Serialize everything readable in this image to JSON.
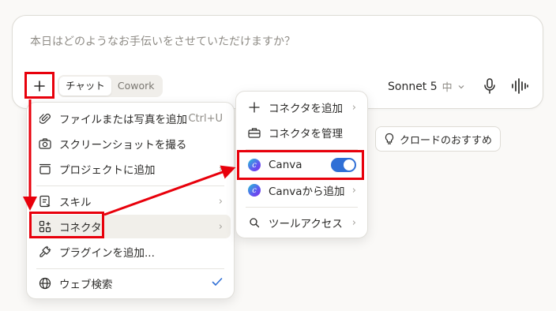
{
  "composer": {
    "placeholder": "本日はどのようなお手伝いをさせていただけますか？",
    "modes": [
      "チャット",
      "Cowork"
    ],
    "model": "Sonnet 5",
    "effort": "中"
  },
  "suggestion_chip": {
    "label": "クロードのおすすめ",
    "icon": "lightbulb-icon"
  },
  "main_menu": {
    "items": [
      {
        "label": "ファイルまたは写真を追加",
        "shortcut": "Ctrl+U",
        "icon": "paperclip-icon"
      },
      {
        "label": "スクリーンショットを撮る",
        "icon": "camera-icon"
      },
      {
        "label": "プロジェクトに追加",
        "icon": "project-box-icon"
      },
      {
        "label": "スキル",
        "icon": "skill-icon"
      },
      {
        "label": "コネクタ",
        "icon": "connector-icon"
      },
      {
        "label": "プラグインを追加...",
        "icon": "plugin-icon"
      },
      {
        "label": "ウェブ検索",
        "icon": "globe-icon",
        "checked": true
      }
    ]
  },
  "sub_menu": {
    "items": [
      {
        "label": "コネクタを追加",
        "icon": "plus-icon"
      },
      {
        "label": "コネクタを管理",
        "icon": "toolbox-icon"
      },
      {
        "label": "Canva",
        "icon": "canva-icon",
        "enabled": true
      },
      {
        "label": "Canvaから追加",
        "icon": "canva-icon"
      },
      {
        "label": "ツールアクセス",
        "icon": "search-icon"
      }
    ]
  },
  "colors": {
    "accent_toggle": "#2f6fd6",
    "annotation_red": "#e8000b",
    "check_blue": "#2f6fd6"
  }
}
